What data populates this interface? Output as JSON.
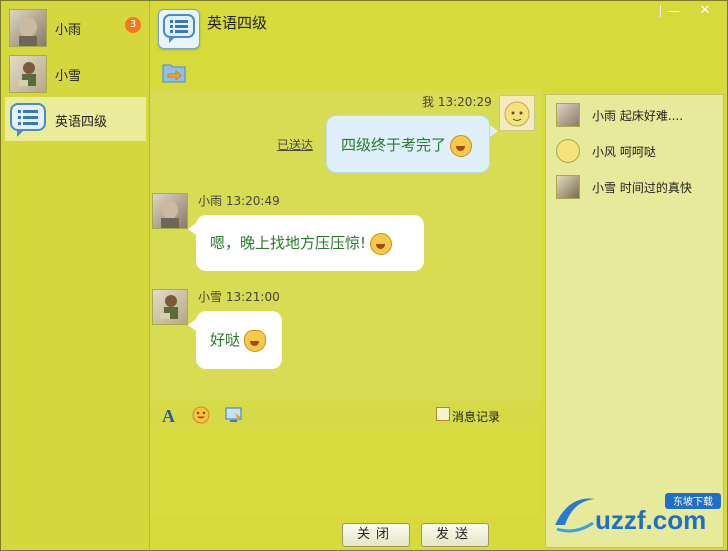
{
  "window": {
    "minimize_label": "—",
    "close_label": "✕"
  },
  "sidebar": {
    "contacts": [
      {
        "name": "小雨",
        "badge": "3",
        "avatar": "boy-photo"
      },
      {
        "name": "小雪",
        "avatar": "boy-reading-photo"
      },
      {
        "name": "英语四级",
        "avatar": "chat-bubble-icon",
        "active": true
      }
    ]
  },
  "header": {
    "title": "英语四级",
    "icon": "chat-bubble-icon",
    "folder_icon": "folder-icon"
  },
  "messages": [
    {
      "sender": "我",
      "time": "13:20:29",
      "text": "四级终于考完了",
      "status": "已送达",
      "emoji": "grin-emoji"
    },
    {
      "sender": "小雨",
      "time": "13:20:49",
      "text": "嗯，晚上找地方压压惊!",
      "emoji": "angry-emoji"
    },
    {
      "sender": "小雪",
      "time": "13:21:00",
      "text": "好哒",
      "emoji": "ok-hand-emoji"
    }
  ],
  "toolbar": {
    "font_icon": "font-icon",
    "emoji_icon": "smile-icon",
    "screenshot_icon": "screen-icon",
    "history_label": "消息记录"
  },
  "buttons": {
    "close_label": "关闭",
    "send_label": "发送"
  },
  "members": [
    {
      "name": "小雨",
      "last": "起床好难...."
    },
    {
      "name": "小风",
      "last": "呵呵哒"
    },
    {
      "name": "小雪",
      "last": "时间过的真快"
    }
  ],
  "watermark": {
    "text": "uzzf.com",
    "tag": "东坡下载"
  },
  "colors": {
    "accent": "#d6da3a",
    "badge": "#f07a1c",
    "bubble_me": "#dff0fb",
    "bubble_other": "#ffffff",
    "message_text": "#2a7a2a"
  }
}
